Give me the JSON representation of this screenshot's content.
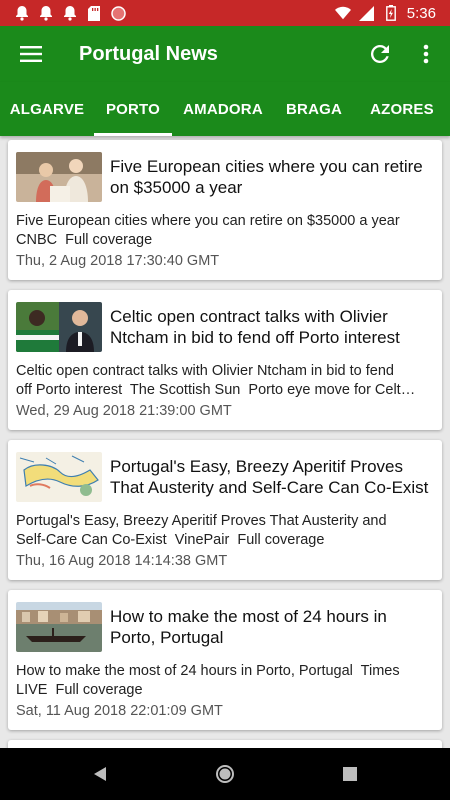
{
  "status_bar": {
    "time": "5:36",
    "left_icons": [
      "notification-bell-icon",
      "notification-bell-icon",
      "notification-bell-icon",
      "sd-card-icon",
      "circle-app-icon"
    ],
    "right_icons": [
      "wifi-icon",
      "signal-icon",
      "battery-charging-icon"
    ]
  },
  "toolbar": {
    "title": "Portugal News",
    "icons": {
      "menu": "hamburger-menu-icon",
      "refresh": "refresh-icon",
      "more": "more-vert-icon"
    }
  },
  "tabs": [
    {
      "label": "ALGARVE",
      "active": false
    },
    {
      "label": "PORTO",
      "active": true
    },
    {
      "label": "AMADORA",
      "active": false
    },
    {
      "label": "BRAGA",
      "active": false
    },
    {
      "label": "AZORES",
      "active": false
    }
  ],
  "articles": [
    {
      "title": "Five European cities where you can retire on $35000 a year",
      "description": "Five European cities where you can retire on $35000 a year\nCNBC  Full coverage",
      "date": "Thu, 2 Aug 2018 17:30:40 GMT"
    },
    {
      "title": "Celtic open contract talks with Olivier Ntcham in bid to fend off Porto interest",
      "description": "Celtic open contract talks with Olivier Ntcham in bid to fend\noff Porto interest  The Scottish Sun  Porto eye move for Celt…",
      "date": "Wed, 29 Aug 2018 21:39:00 GMT"
    },
    {
      "title": "Portugal's Easy, Breezy Aperitif Proves That Austerity and Self-Care Can Co-Exist",
      "description": "Portugal's Easy, Breezy Aperitif Proves That Austerity and\nSelf-Care Can Co-Exist  VinePair  Full coverage",
      "date": "Thu, 16 Aug 2018 14:14:38 GMT"
    },
    {
      "title": "How to make the most of 24 hours in Porto, Portugal",
      "description": "How to make the most of 24 hours in Porto, Portugal  Times\nLIVE  Full coverage",
      "date": "Sat, 11 Aug 2018 22:01:09 GMT"
    }
  ],
  "nav_bar": {
    "icons": [
      "back-icon",
      "home-icon",
      "recents-icon"
    ]
  },
  "colors": {
    "status_bar": "#c62828",
    "app_bar": "#1b8a1b",
    "background": "#e8e8e8",
    "nav_bar": "#000000"
  }
}
